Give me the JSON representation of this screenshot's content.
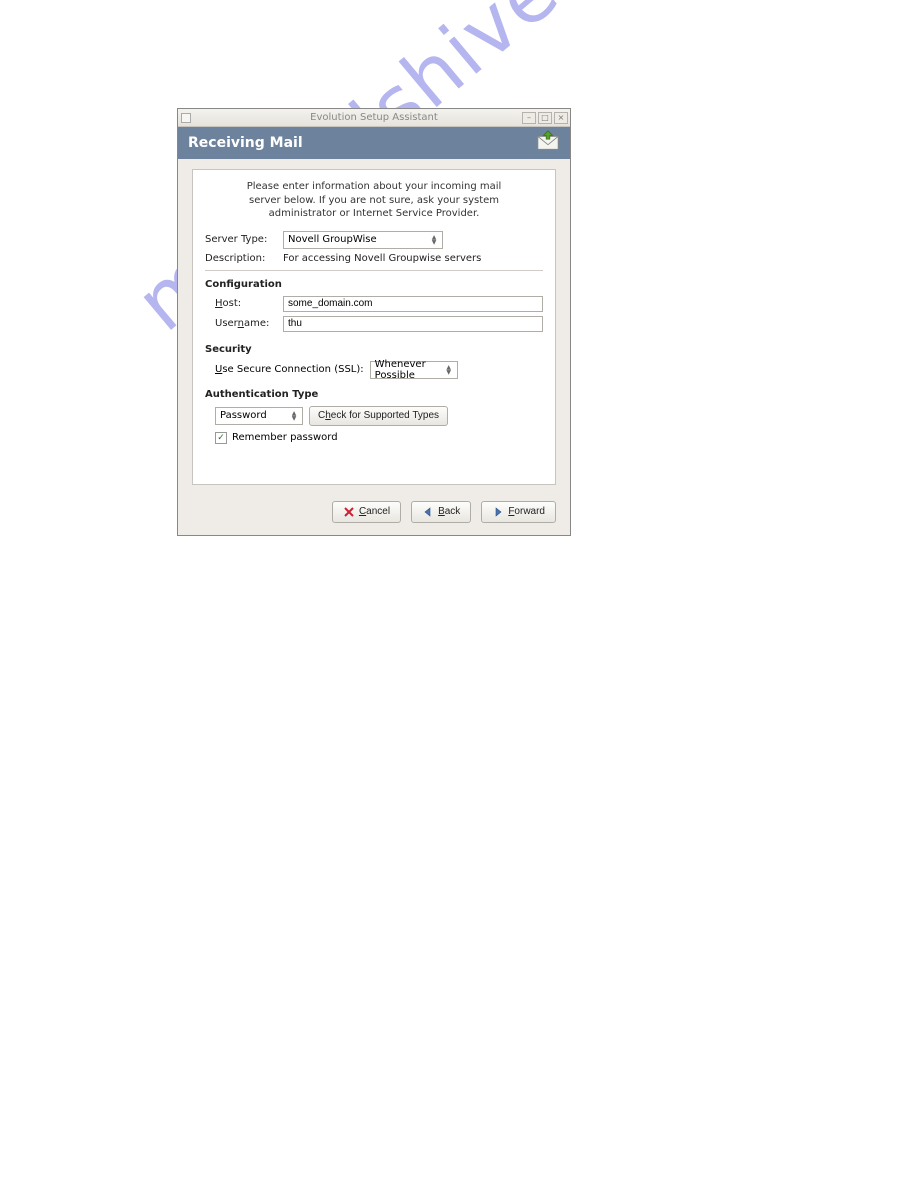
{
  "window": {
    "title": "Evolution Setup Assistant"
  },
  "header": {
    "title": "Receiving Mail"
  },
  "intro": {
    "line1": "Please enter information about your incoming mail",
    "line2": "server below. If you are not sure, ask your system",
    "line3": "administrator or Internet Service Provider."
  },
  "server": {
    "type_label": "Server Type:",
    "type_value": "Novell GroupWise",
    "desc_label": "Description:",
    "desc_value": "For accessing Novell Groupwise servers"
  },
  "config": {
    "title": "Configuration",
    "host_label": "Host:",
    "host_value": "some_domain.com",
    "username_label": "Username:",
    "username_value": "thu"
  },
  "security": {
    "title": "Security",
    "ssl_label": "Use Secure Connection (SSL):",
    "ssl_value": "Whenever Possible"
  },
  "auth": {
    "title": "Authentication Type",
    "type_value": "Password",
    "check_label": "Check for Supported Types",
    "remember_label": "Remember password",
    "remember_checked": true
  },
  "footer": {
    "cancel": "Cancel",
    "back": "Back",
    "forward": "Forward"
  },
  "watermark": "manualshive.com"
}
